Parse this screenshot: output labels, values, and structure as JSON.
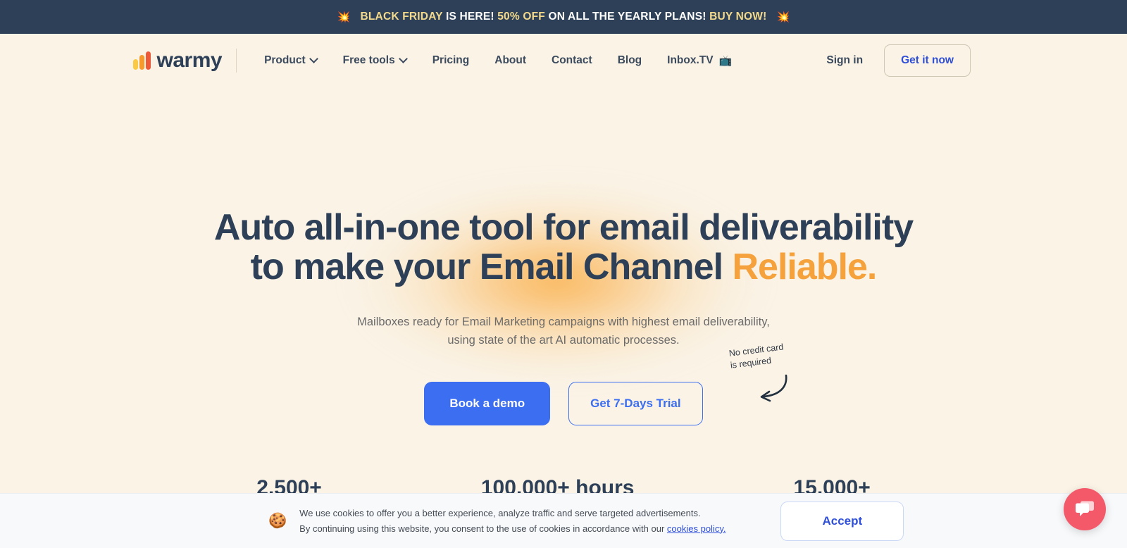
{
  "promo": {
    "spark_left": "💥",
    "spark_right": "💥",
    "part1": "BLACK FRIDAY ",
    "part2": "IS HERE! ",
    "part3": "50% OFF ",
    "part4": "ON ALL THE YEARLY PLANS! ",
    "part5": "BUY NOW!",
    "bg_color": "#2e4057",
    "gold_color": "#f2d98c"
  },
  "header": {
    "logo_text": "warmy",
    "logo_bar_colors": [
      "#fbc944",
      "#f79a2e",
      "#ed5a3a"
    ],
    "nav": [
      {
        "label": "Product",
        "has_chevron": true,
        "icon": "chevron-down-icon"
      },
      {
        "label": "Free tools",
        "has_chevron": true,
        "icon": "chevron-down-icon"
      },
      {
        "label": "Pricing",
        "has_chevron": false
      },
      {
        "label": "About",
        "has_chevron": false
      },
      {
        "label": "Contact",
        "has_chevron": false
      },
      {
        "label": "Blog",
        "has_chevron": false
      },
      {
        "label": "Inbox.TV",
        "has_chevron": false,
        "emoji": "📺"
      }
    ],
    "sign_in": "Sign in",
    "get_it_now": "Get it now",
    "accent_color": "#2f4fd8"
  },
  "hero": {
    "headline_line1": "Auto all-in-one tool for email deliverability",
    "headline_line2_plain": "to make your Email Channel ",
    "headline_line2_accent": "Reliable.",
    "headline_color": "#2e4057",
    "accent_color": "#f5a13c",
    "sub_line1": "Mailboxes ready for Email Marketing campaigns with highest email deliverability,",
    "sub_line2": "using state of the art AI automatic processes.",
    "cta_primary": "Book a demo",
    "cta_secondary": "Get 7-Days Trial",
    "note": "No credit card\nis required",
    "primary_color": "#3b6ef0"
  },
  "stats": [
    {
      "value": "2,500+"
    },
    {
      "value": "100,000+ hours"
    },
    {
      "value": "15,000+"
    }
  ],
  "cookie": {
    "emoji": "🍪",
    "line1": "We use cookies to offer you a better experience, analyze traffic and serve targeted advertisements.",
    "line2_pre": "By continuing using this website, you consent to the use of cookies in accordance with our ",
    "link": "cookies policy.",
    "accept": "Accept"
  },
  "chat": {
    "icon": "chat-bubble-icon",
    "color": "#f4596a"
  }
}
